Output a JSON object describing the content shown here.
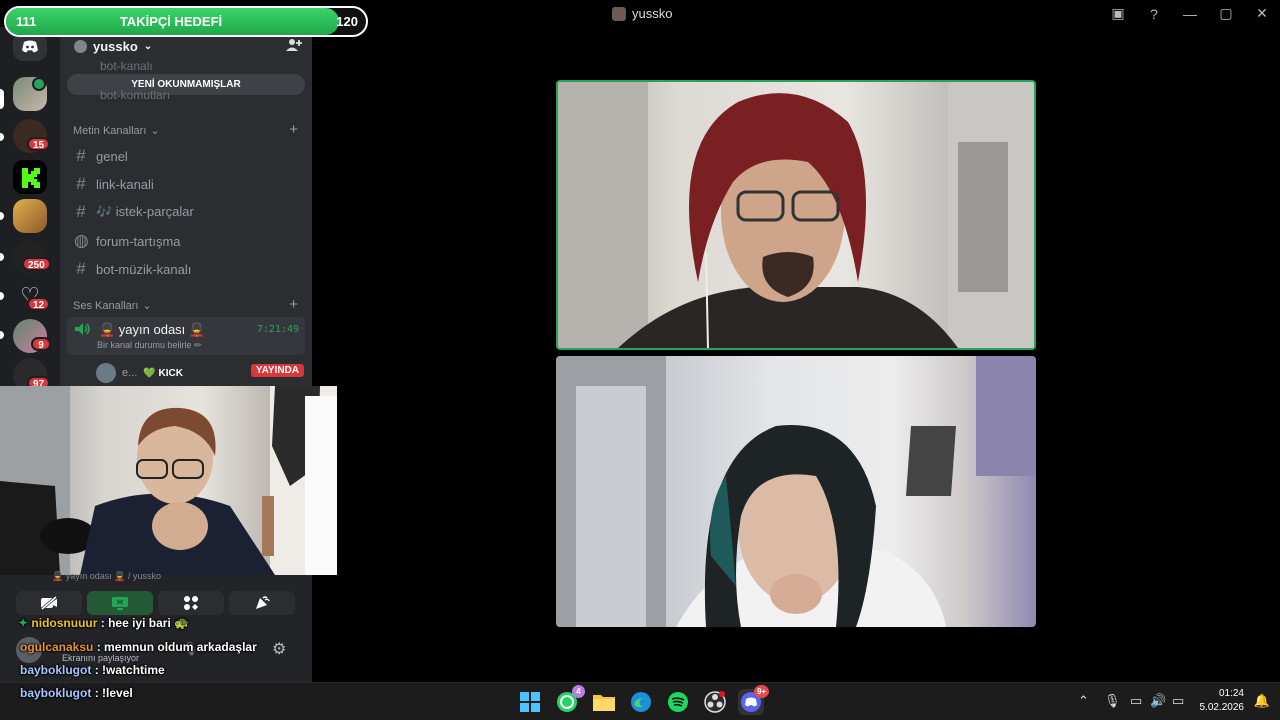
{
  "window": {
    "title": "yussko"
  },
  "goal_overlay": {
    "current": "111",
    "title": "TAKİPÇİ HEDEFİ",
    "target": "120",
    "progress": 0.925
  },
  "server_rail": {
    "badges": [
      "15",
      "250",
      "12",
      "9",
      "97"
    ]
  },
  "sidebar": {
    "server_name": "yussko",
    "unread_pill": "YENİ OKUNMAMIŞLAR",
    "ghost_channels": [
      "bot-kanalı",
      "bot-komutları"
    ],
    "text_category": "Metin Kanalları",
    "text_channels": [
      {
        "label": "genel"
      },
      {
        "label": "link-kanali"
      },
      {
        "label": "🎶 istek-parçalar"
      },
      {
        "label": "forum-tartışma"
      },
      {
        "label": "bot-müzik-kanalı"
      }
    ],
    "voice_category": "Ses Kanalları",
    "voice_channel": {
      "name": "💂 yayın odası 💂",
      "timer": "7:21:49",
      "status": "Bir kanal durumu belirle ✏"
    },
    "member": {
      "name": "e...",
      "tag": "💚 KICK",
      "live": "YAYINDA"
    }
  },
  "panel": {
    "faded_text": "💂 yayın odası 💂 / yussko",
    "sharing": "Ekranını paylaşıyor"
  },
  "chat": [
    {
      "user": "nidosnuuur",
      "text": ": hee iyi bari 🐢"
    },
    {
      "user": "ogulcanaksu",
      "text": ": memnun oldum arkadaşlar"
    },
    {
      "user": "bayboklugot",
      "text": ": !watchtime"
    },
    {
      "user": "bayboklugot",
      "text": ": !level"
    }
  ],
  "taskbar": {
    "whatsapp_badge": "4",
    "discord_badge": "9+",
    "time": "01:24",
    "date": "5.02.2026"
  }
}
